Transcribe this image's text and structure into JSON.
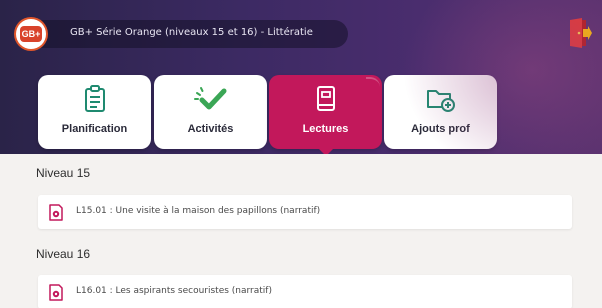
{
  "header": {
    "title": "GB+ Série Orange (niveaux 15 et 16) - Littératie",
    "logo_text": "GB+"
  },
  "tabs": [
    {
      "label": "Planification",
      "icon": "clipboard-icon",
      "active": false
    },
    {
      "label": "Activités",
      "icon": "checkmark-icon",
      "active": false
    },
    {
      "label": "Lectures",
      "icon": "book-icon",
      "active": true
    },
    {
      "label": "Ajouts prof",
      "icon": "folder-add-icon",
      "active": false
    }
  ],
  "sections": [
    {
      "title": "Niveau 15",
      "items": [
        {
          "label": "L15.01 : Une visite à la maison des papillons (narratif)"
        }
      ]
    },
    {
      "title": "Niveau 16",
      "items": [
        {
          "label": "L16.01 : Les aspirants secouristes (narratif)"
        }
      ]
    }
  ],
  "colors": {
    "accent": "#c2185b",
    "header_dark": "#2a2348",
    "icon_green": "#3aa655",
    "icon_teal": "#1f8a70",
    "exit_red": "#e53935"
  }
}
